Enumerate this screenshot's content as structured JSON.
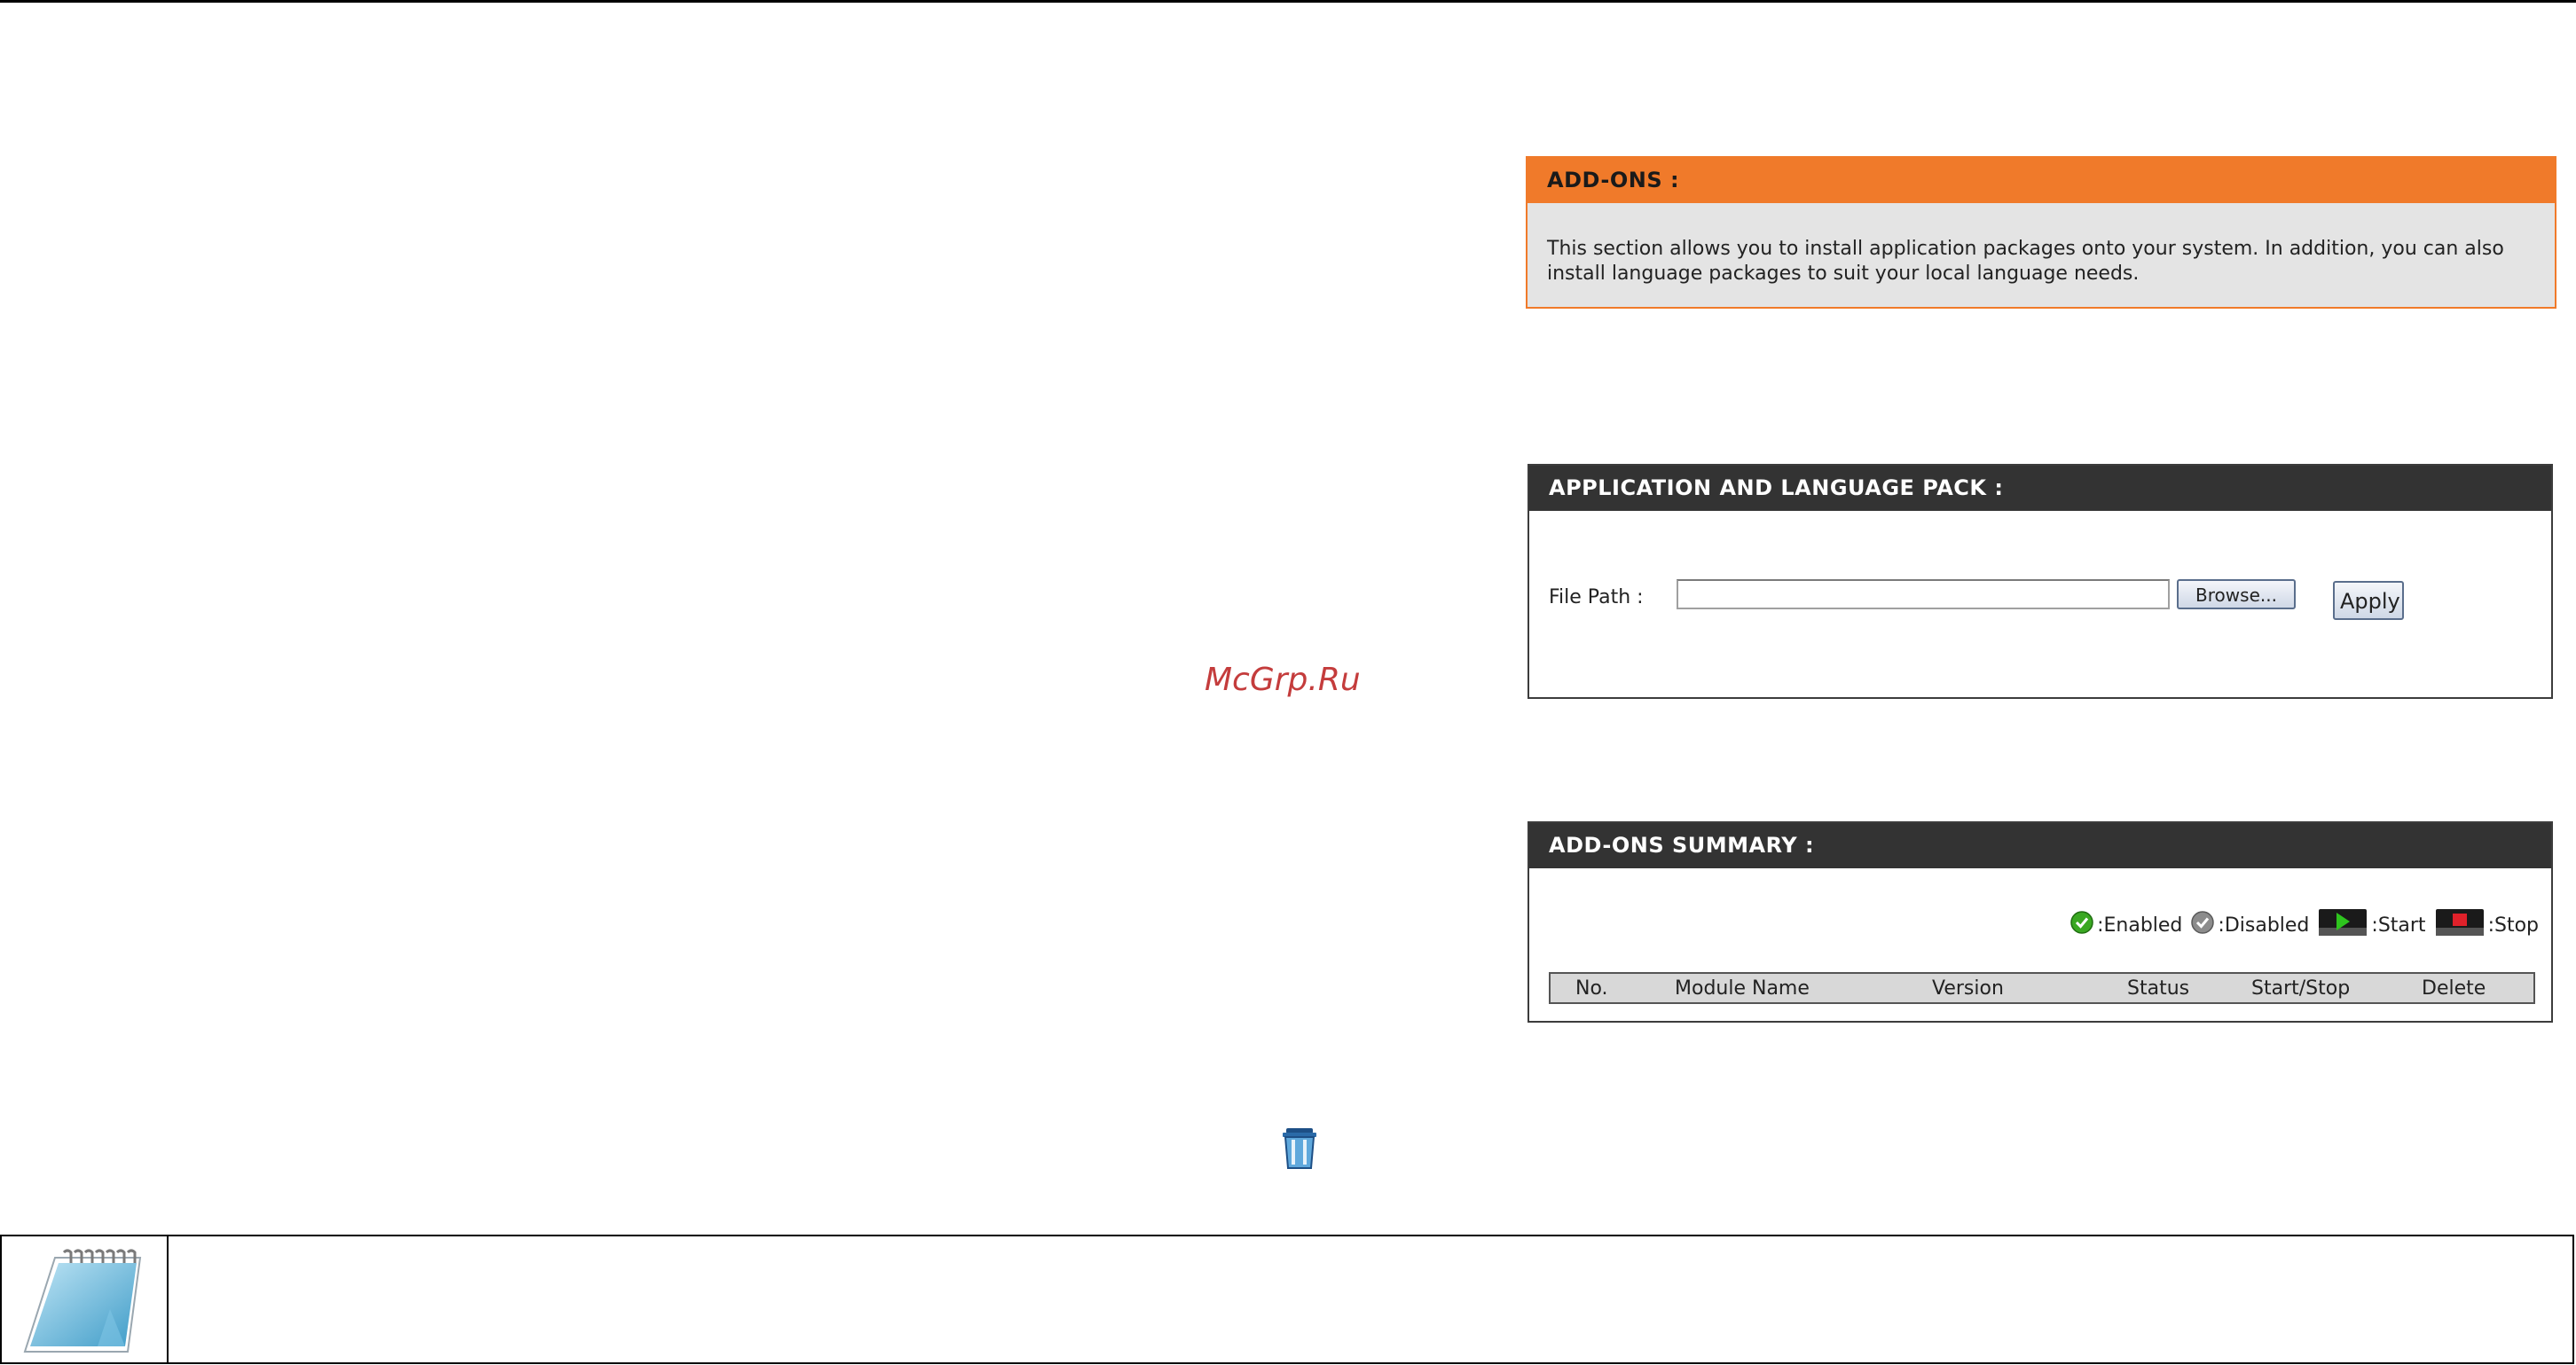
{
  "addons": {
    "title": "ADD-ONS :",
    "description_line1": "This section allows you to install application packages onto your system. In addition, you can also",
    "description_line2": "install language packages to suit your local language needs."
  },
  "pack": {
    "title": "APPLICATION AND LANGUAGE PACK :",
    "file_path_label": "File Path :",
    "file_path_value": "",
    "browse_label": "Browse...",
    "apply_label": "Apply"
  },
  "watermark": "McGrp.Ru",
  "summary": {
    "title": "ADD-ONS SUMMARY :",
    "legend": {
      "enabled": ":Enabled",
      "disabled": ":Disabled",
      "start": ":Start",
      "stop": ":Stop"
    },
    "columns": [
      "No.",
      "Module Name",
      "Version",
      "Status",
      "Start/Stop",
      "Delete"
    ]
  },
  "icons": {
    "enabled": "check-circle-green-icon",
    "disabled": "check-circle-gray-icon",
    "start": "play-icon",
    "stop": "stop-icon",
    "delete": "trash-icon",
    "note": "notepad-icon"
  },
  "colors": {
    "addons_header": "#f07a2a",
    "section_header": "#333333",
    "addons_body": "#e4e4e4",
    "watermark": "#c43c3c"
  }
}
